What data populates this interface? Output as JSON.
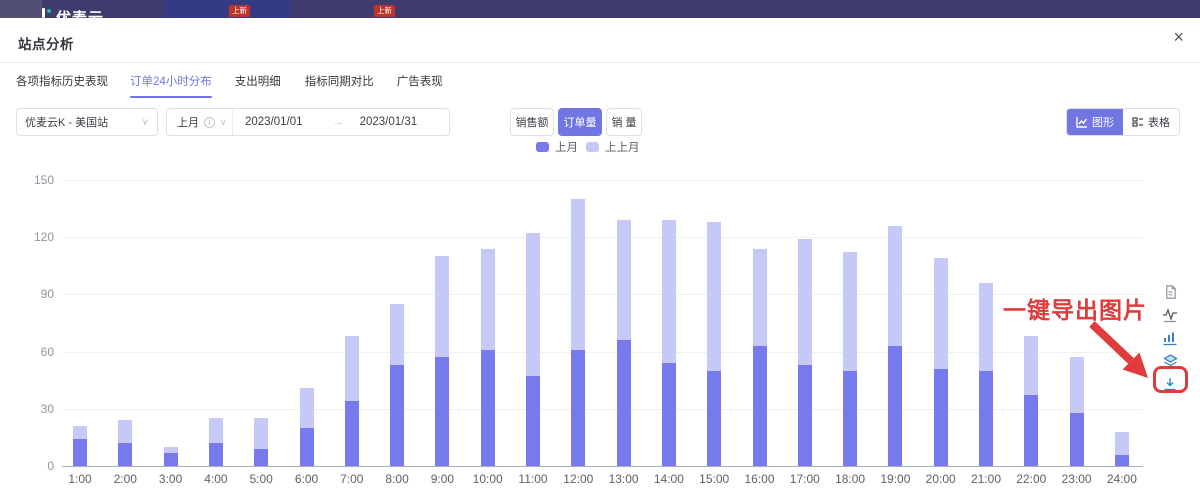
{
  "topbar": {
    "logo_text": "优麦云",
    "badge1": "上新",
    "badge2": "上新"
  },
  "modal": {
    "title": "站点分析",
    "close": "×"
  },
  "tabs": [
    {
      "label": "各项指标历史表现",
      "active": false
    },
    {
      "label": "订单24小时分布",
      "active": true
    },
    {
      "label": "支出明细",
      "active": false
    },
    {
      "label": "指标同期对比",
      "active": false
    },
    {
      "label": "广告表现",
      "active": false
    }
  ],
  "filters": {
    "site_select": "优麦云K - 美国站",
    "period_select": "上月",
    "date_start": "2023/01/01",
    "date_arrow": "→",
    "date_end": "2023/01/31",
    "metric_buttons": [
      {
        "label": "销售额",
        "active": false
      },
      {
        "label": "订单量",
        "active": true
      },
      {
        "label": "销 量",
        "active": false
      }
    ],
    "view_toggle": [
      {
        "label": "图形",
        "active": true
      },
      {
        "label": "表格",
        "active": false
      }
    ]
  },
  "legend": [
    {
      "label": "上月",
      "color": "#777AEC"
    },
    {
      "label": "上上月",
      "color": "#C6C8F8"
    }
  ],
  "chart_data": {
    "type": "bar",
    "stacked": true,
    "title": "",
    "xlabel": "",
    "ylabel": "",
    "ylim": [
      0,
      150
    ],
    "yticks": [
      0,
      30,
      60,
      90,
      120,
      150
    ],
    "grid": true,
    "legend_position": "top",
    "categories": [
      "1:00",
      "2:00",
      "3:00",
      "4:00",
      "5:00",
      "6:00",
      "7:00",
      "8:00",
      "9:00",
      "10:00",
      "11:00",
      "12:00",
      "13:00",
      "14:00",
      "15:00",
      "16:00",
      "17:00",
      "18:00",
      "19:00",
      "20:00",
      "21:00",
      "22:00",
      "23:00",
      "24:00"
    ],
    "series": [
      {
        "name": "上月",
        "color": "#777AEC",
        "values": [
          14,
          12,
          7,
          12,
          9,
          20,
          34,
          53,
          57,
          61,
          47,
          61,
          66,
          54,
          50,
          63,
          53,
          50,
          63,
          51,
          50,
          37,
          28,
          6
        ]
      },
      {
        "name": "上上月",
        "color": "#C6C8F8",
        "values": [
          7,
          12,
          3,
          13,
          16,
          21,
          34,
          32,
          53,
          53,
          75,
          79,
          63,
          75,
          78,
          51,
          66,
          62,
          63,
          58,
          46,
          31,
          29,
          12
        ]
      }
    ]
  },
  "side_toolbar": [
    "document",
    "line-chart",
    "bar-chart",
    "layers",
    "download"
  ],
  "annotation": {
    "text": "一键导出图片",
    "color": "#E03C3C"
  }
}
